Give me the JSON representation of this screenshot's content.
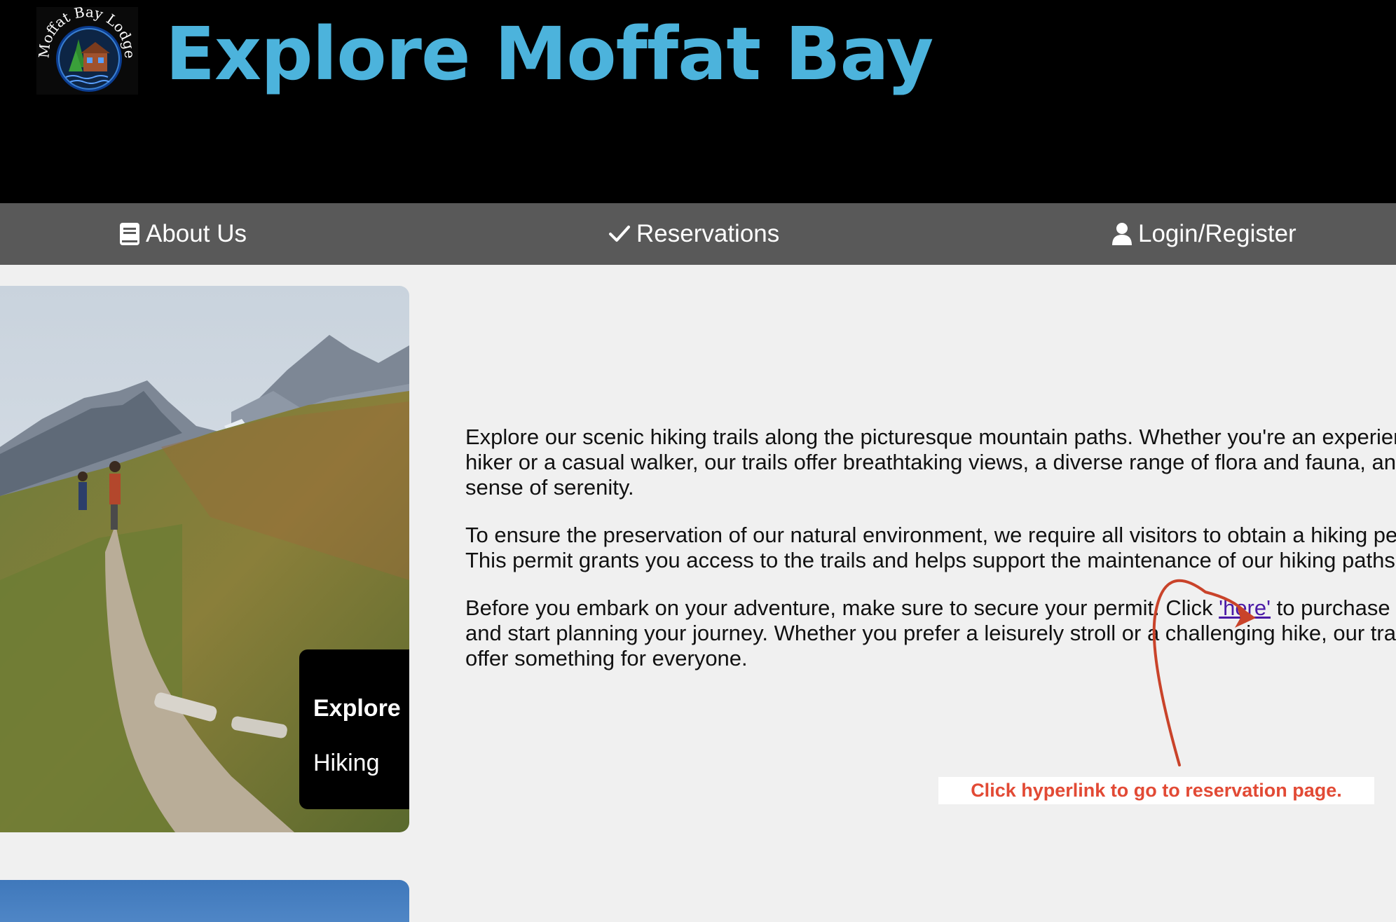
{
  "header": {
    "title": "Explore Moffat Bay",
    "logo_text": "Moffat Bay Lodge"
  },
  "nav": {
    "items": [
      {
        "label": "About Us",
        "icon": "book-icon"
      },
      {
        "label": "Reservations",
        "icon": "checkmark-icon"
      },
      {
        "label": "Login/Register",
        "icon": "user-icon"
      }
    ]
  },
  "card": {
    "title": "Explore",
    "subtitle": "Hiking"
  },
  "content": {
    "paragraph1": "Explore our scenic hiking trails along the picturesque mountain paths. Whether you're an experienced hiker or a casual walker, our trails offer breathtaking views, a diverse range of flora and fauna, and a sense of serenity.",
    "paragraph2": "To ensure the preservation of our natural environment, we require all visitors to obtain a hiking permit. This permit grants you access to the trails and helps support the maintenance of our hiking paths.",
    "paragraph3_before": "Before you embark on your adventure, make sure to secure your permit. Click ",
    "link_text": "'here'",
    "paragraph3_after": " to purchase one and start planning your journey. Whether you prefer a leisurely stroll or a challenging hike, our trails offer something for everyone."
  },
  "annotation": {
    "text": "Click hyperlink to go to reservation page."
  },
  "colors": {
    "header_bg": "#000000",
    "title": "#4cb3dc",
    "nav_bg": "#595959",
    "page_bg": "#f0f0f0",
    "link": "#4b1aa6",
    "annotation": "#e24a35"
  }
}
